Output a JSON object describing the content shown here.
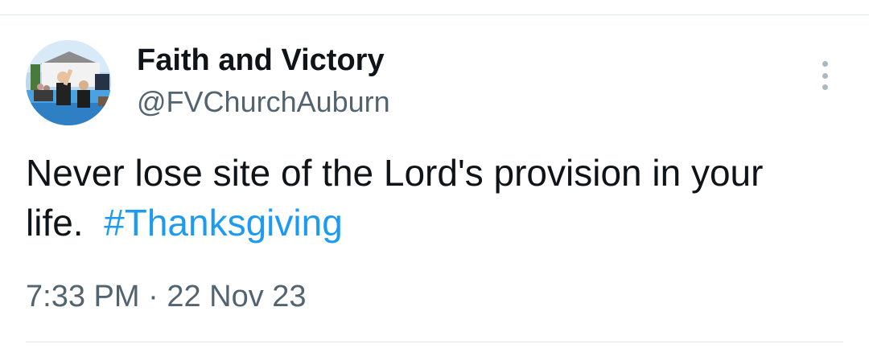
{
  "tweet": {
    "author": {
      "display_name": "Faith and Victory",
      "handle": "@FVChurchAuburn",
      "avatar_icon": "church-baptism-photo"
    },
    "text_before_hashtag": "Never lose site of the Lord's provision in your life.",
    "hashtag": "#Thanksgiving",
    "time": "7:33 PM",
    "separator": "·",
    "date": "22 Nov 23",
    "more_icon": "vertical-ellipsis-icon"
  },
  "colors": {
    "text": "#0f1419",
    "secondary": "#536471",
    "link": "#1d9bf0",
    "divider": "#e1e8ed"
  }
}
